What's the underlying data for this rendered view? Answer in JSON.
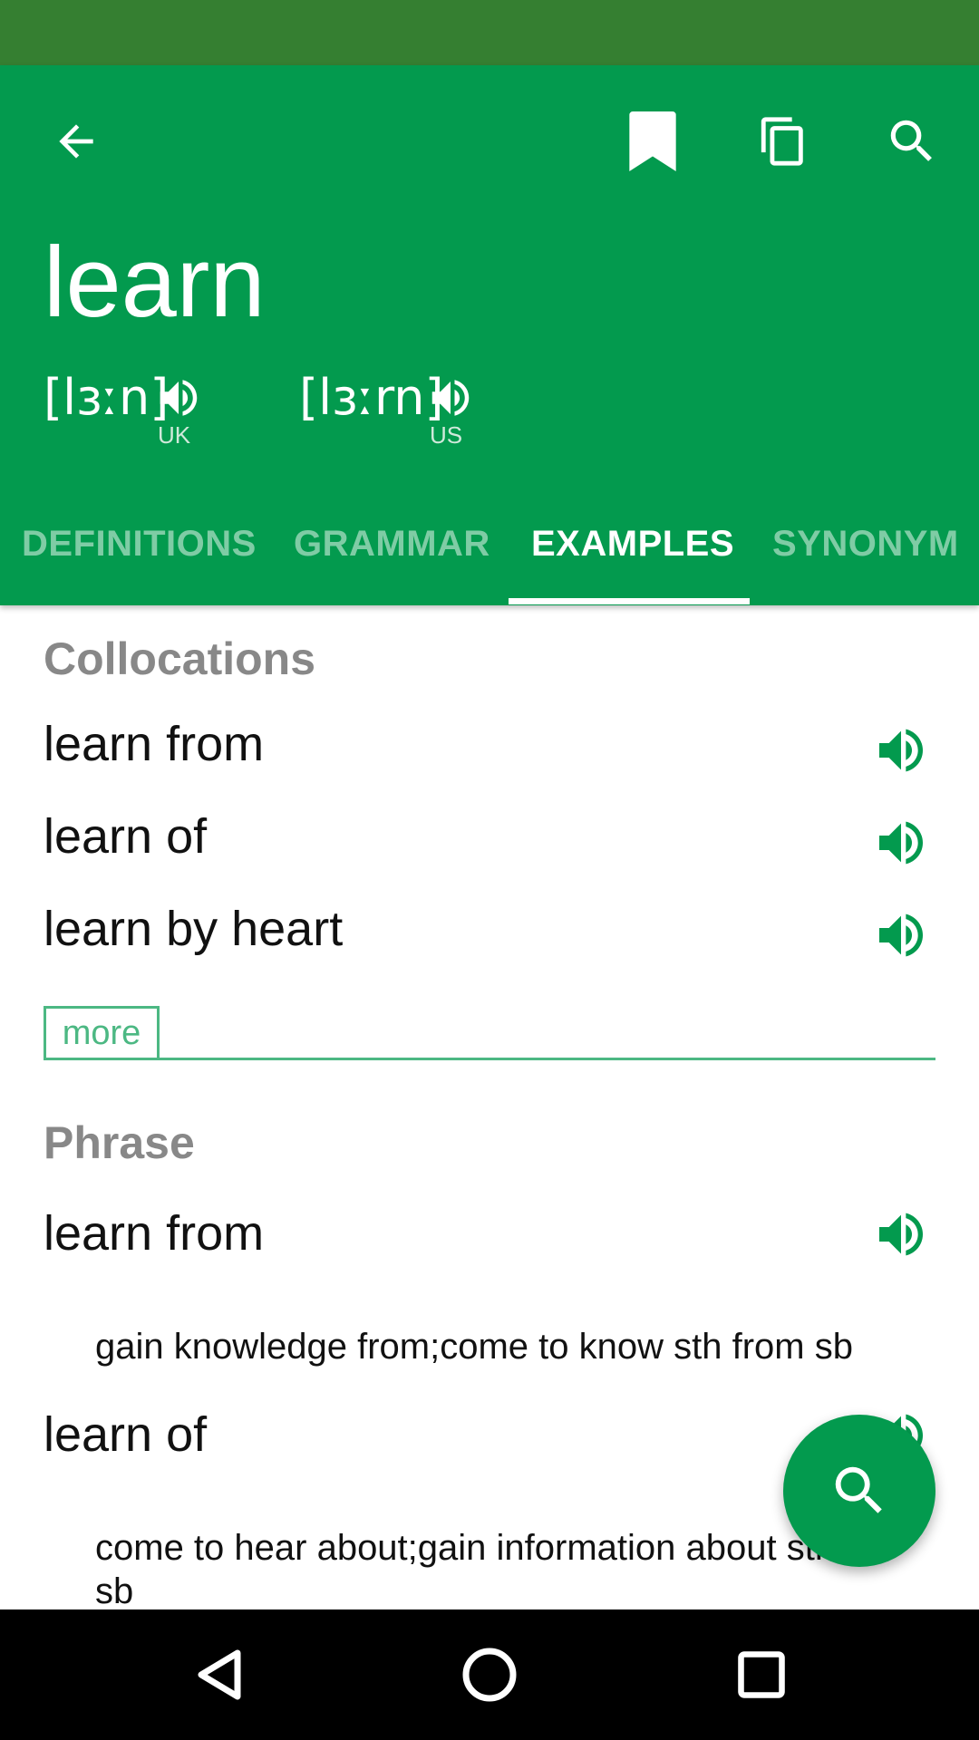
{
  "header": {
    "word": "learn",
    "pronunciations": [
      {
        "ipa": "[lɜːn]",
        "region": "UK"
      },
      {
        "ipa": "[lɜːrn]",
        "region": "US"
      }
    ]
  },
  "icons": {
    "back": "arrow-left-icon",
    "bookmark": "bookmark-icon",
    "copy": "copy-icon",
    "search": "search-icon",
    "speaker": "speaker-icon"
  },
  "tabs": [
    {
      "label": "DEFINITIONS",
      "active": false
    },
    {
      "label": "GRAMMAR",
      "active": false
    },
    {
      "label": "EXAMPLES",
      "active": true
    },
    {
      "label": "SYNONYM",
      "active": false
    }
  ],
  "collocations": {
    "title": "Collocations",
    "items": [
      "learn from",
      "learn of",
      "learn by heart"
    ],
    "more_label": "more"
  },
  "phrase": {
    "title": "Phrase",
    "items": [
      {
        "phrase": "learn from",
        "gloss": "gain knowledge from;come to know sth from sb"
      },
      {
        "phrase": "learn of",
        "gloss": "come to hear about;gain information about sth or sb"
      }
    ]
  },
  "colors": {
    "status_bar": "#357f31",
    "primary": "#039a4e",
    "tab_inactive": "#7fcca5",
    "accent_outline": "#4cb883",
    "section_title": "#888888"
  }
}
